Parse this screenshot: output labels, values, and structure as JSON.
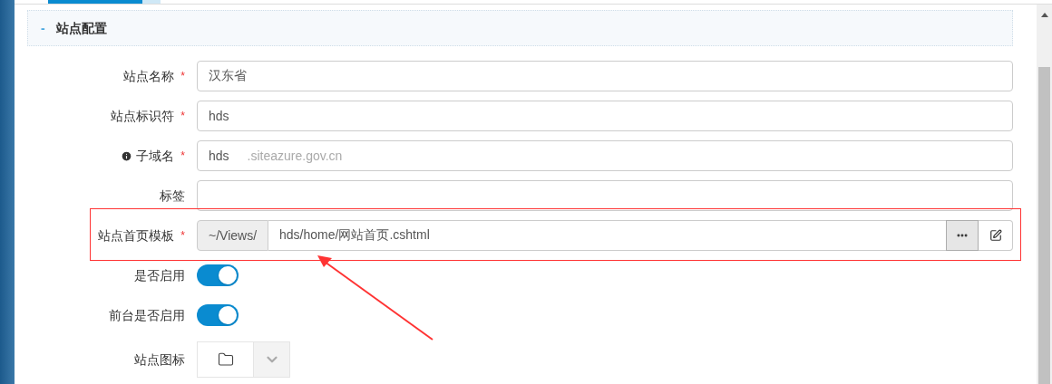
{
  "section": {
    "symbol": "-",
    "title": "站点配置"
  },
  "fields": [
    {
      "kind": "text",
      "label": "站点名称",
      "required_mark": "*",
      "info": false,
      "value": "汉东省"
    },
    {
      "kind": "text",
      "label": "站点标识符",
      "required_mark": "*",
      "info": false,
      "value": "hds"
    },
    {
      "kind": "subdomain",
      "label": "子域名",
      "required_mark": "*",
      "info": true,
      "value": "hds",
      "suffix": ".siteazure.gov.cn"
    },
    {
      "kind": "text",
      "label": "标签",
      "info": false
    },
    {
      "kind": "template",
      "label": "站点首页模板",
      "required_mark": "*",
      "info": false,
      "prefix": "~/Views/",
      "value": "hds/home/网站首页.cshtml"
    },
    {
      "kind": "toggle",
      "label": "是否启用",
      "info": false,
      "on": true
    },
    {
      "kind": "toggle",
      "label": "前台是否启用",
      "info": false,
      "on": true
    },
    {
      "kind": "icon",
      "label": "站点图标",
      "info": false
    }
  ]
}
